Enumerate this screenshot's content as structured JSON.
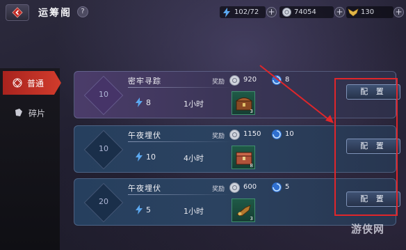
{
  "header": {
    "title": "运筹阁",
    "help_icon": "?",
    "resources": [
      {
        "icon": "lightning-icon",
        "value": "102/72"
      },
      {
        "icon": "coin-icon",
        "value": "74054"
      },
      {
        "icon": "wings-icon",
        "value": "130"
      }
    ],
    "plus_label": "+"
  },
  "tabs": [
    {
      "label": "普通",
      "icon": "diamond-icon",
      "active": true
    },
    {
      "label": "碎片",
      "icon": "fragment-icon",
      "active": false
    }
  ],
  "reward_label": "奖励",
  "tasks": [
    {
      "level": "10",
      "name": "密牢寻踪",
      "energy": "8",
      "duration": "1小时",
      "coins": "920",
      "swirl": "8",
      "item_count": "3",
      "style": "purple",
      "config_label": "配 置"
    },
    {
      "level": "10",
      "name": "午夜埋伏",
      "energy": "10",
      "duration": "4小时",
      "coins": "1150",
      "swirl": "10",
      "item_count": "8",
      "style": "blue",
      "config_label": "配 置"
    },
    {
      "level": "20",
      "name": "午夜埋伏",
      "energy": "5",
      "duration": "1小时",
      "coins": "600",
      "swirl": "5",
      "item_count": "3",
      "style": "blue",
      "config_label": "配 置"
    }
  ],
  "watermark": "游侠网",
  "colors": {
    "accent_red": "#e0262a",
    "tab_active": "#c2322a"
  }
}
